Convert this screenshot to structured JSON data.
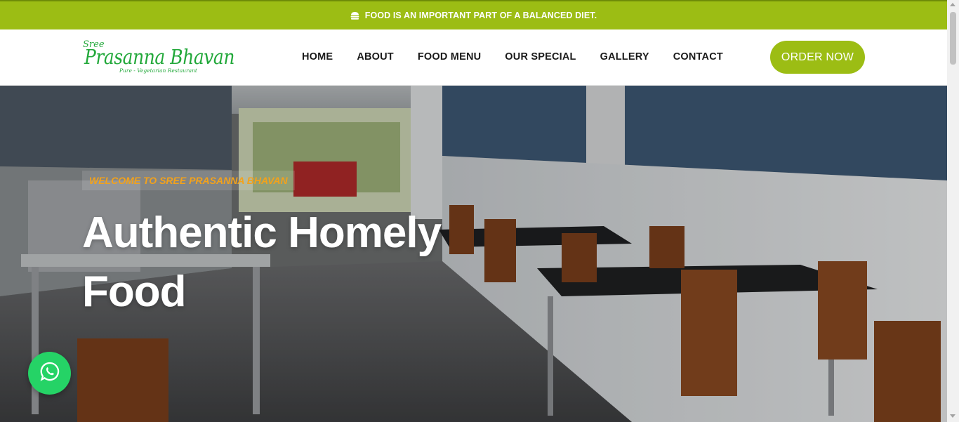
{
  "announcement": {
    "text": "FOOD IS AN IMPORTANT PART OF A BALANCED DIET.",
    "icon": "burger-icon"
  },
  "logo": {
    "prefix": "Sree",
    "name": "Prasanna Bhavan",
    "tagline": "Pure - Vegetarian Restaurant"
  },
  "nav": {
    "items": [
      {
        "label": "HOME"
      },
      {
        "label": "ABOUT"
      },
      {
        "label": "FOOD MENU"
      },
      {
        "label": "OUR SPECIAL"
      },
      {
        "label": "GALLERY"
      },
      {
        "label": "CONTACT"
      }
    ]
  },
  "order_button": {
    "label": "ORDER NOW"
  },
  "hero": {
    "welcome": "WELCOME TO SREE PRASANNA BHAVAN",
    "headline_line1": "Authentic Homely",
    "headline_line2": "Food"
  },
  "whatsapp": {
    "icon": "whatsapp-icon"
  },
  "colors": {
    "accent": "#9cbd14",
    "logo_green": "#22a83a",
    "welcome_orange": "#f3a21b",
    "whatsapp_green": "#25d366"
  }
}
